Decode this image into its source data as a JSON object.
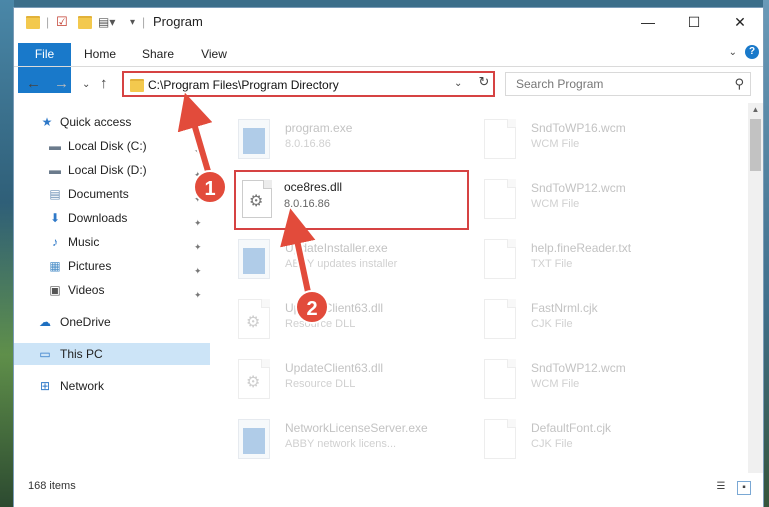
{
  "window": {
    "title": "Program",
    "controls": {
      "minimize": "—",
      "maximize": "☐",
      "close": "✕"
    }
  },
  "ribbon": {
    "tabs": [
      "File",
      "Home",
      "Share",
      "View"
    ],
    "expand_glyph": "⌄",
    "help_glyph": "?"
  },
  "nav": {
    "back": "←",
    "forward": "→",
    "recent": "⌄",
    "up": "↑",
    "address": "C:\\Program Files\\Program Directory",
    "address_dropdown": "⌄",
    "refresh": "↻",
    "search_placeholder": "Search Program",
    "search_icon_glyph": "⚲"
  },
  "sidebar": {
    "items": [
      {
        "label": "Quick access",
        "icon": "star-icon",
        "glyph": "★",
        "color": "#2f79c8",
        "pinned": false
      },
      {
        "label": "Local Disk (C:)",
        "icon": "drive-icon",
        "glyph": "▬",
        "color": "#6b7b8c",
        "pinned": true
      },
      {
        "label": "Local Disk (D:)",
        "icon": "drive-icon",
        "glyph": "▬",
        "color": "#6b7b8c",
        "pinned": true
      },
      {
        "label": "Documents",
        "icon": "documents-icon",
        "glyph": "▤",
        "color": "#6a8fb5",
        "pinned": true
      },
      {
        "label": "Downloads",
        "icon": "download-icon",
        "glyph": "⬇",
        "color": "#2f79c8",
        "pinned": true
      },
      {
        "label": "Music",
        "icon": "music-icon",
        "glyph": "♪",
        "color": "#2f79c8",
        "pinned": true
      },
      {
        "label": "Pictures",
        "icon": "pictures-icon",
        "glyph": "▦",
        "color": "#4c8fc8",
        "pinned": true
      },
      {
        "label": "Videos",
        "icon": "videos-icon",
        "glyph": "▣",
        "color": "#555",
        "pinned": true
      },
      {
        "label": "OneDrive",
        "icon": "cloud-icon",
        "glyph": "☁",
        "color": "#1e6fc0",
        "pinned": false
      },
      {
        "label": "This PC",
        "icon": "computer-icon",
        "glyph": "▭",
        "color": "#2f79c8",
        "pinned": false,
        "selected": true
      },
      {
        "label": "Network",
        "icon": "network-icon",
        "glyph": "⊞",
        "color": "#2f79c8",
        "pinned": false
      }
    ],
    "pin_glyph": "📌"
  },
  "files": {
    "left": [
      {
        "name": "program.exe",
        "type": "8.0.16.86",
        "kind": "app"
      },
      {
        "name": "oce8res.dll",
        "type": "8.0.16.86",
        "kind": "dll"
      },
      {
        "name": "UpdateInstaller.exe",
        "type": "ABBY updates installer",
        "kind": "app"
      },
      {
        "name": "UpdateClient63.dll",
        "type": "Resource DLL",
        "kind": "dll"
      },
      {
        "name": "UpdateClient63.dll",
        "type": "Resource DLL",
        "kind": "dll"
      },
      {
        "name": "NetworkLicenseServer.exe",
        "type": "ABBY network licens...",
        "kind": "app"
      }
    ],
    "right": [
      {
        "name": "SndToWP16.wcm",
        "type": "WCM File"
      },
      {
        "name": "SndToWP12.wcm",
        "type": "WCM File"
      },
      {
        "name": "help.fineReader.txt",
        "type": "TXT File"
      },
      {
        "name": "FastNrml.cjk",
        "type": "CJK File"
      },
      {
        "name": "SndToWP12.wcm",
        "type": "WCM File"
      },
      {
        "name": "DefaultFont.cjk",
        "type": "CJK File"
      }
    ]
  },
  "annotations": {
    "step1": "1",
    "step2": "2"
  },
  "status": {
    "item_count": "168 items"
  },
  "colors": {
    "accent": "#1979ca",
    "highlight": "#d64343",
    "arrow": "#e24b3b",
    "selected": "#cce4f7"
  }
}
